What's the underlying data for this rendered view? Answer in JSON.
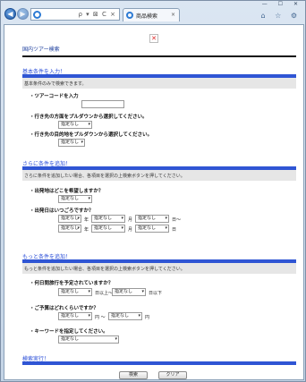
{
  "browser": {
    "tab_title": "商品検索",
    "tab_close": "×",
    "address_icons": "ρ ▾ ⊠ C ×",
    "tool_icons": "⌂ ☆ ⚙",
    "window_controls": "— ☐ ✕",
    "back_glyph": "◀",
    "forward_glyph": "▶"
  },
  "page": {
    "broken_image_glyph": "✕",
    "title": "国内ツアー検索",
    "basic": {
      "heading": "基本条件を入力！",
      "description": "基本条件のみで検索できます。",
      "tour_code_label": "・ツアーコードを入力",
      "destination_area_label": "・行き先の方面をプルダウンから選択してください。",
      "destination_area_select": "指定なし",
      "destination_label": "・行き先の目的地をプルダウンから選択してください。",
      "destination_select": "指定なし"
    },
    "more": {
      "heading": "さらに条件を追加！",
      "description": "さらに条件を追加したい場合、各項目を選択の上検索ボタンを押してください。",
      "departure_place_label": "・出発地はどこを希望しますか？",
      "departure_place_select": "指定なし",
      "departure_date_label": "・出発日はいつごろですか？",
      "date_from": {
        "year": "指定なし",
        "year_suffix": "年",
        "month": "指定なし",
        "month_suffix": "月",
        "day": "指定なし",
        "day_suffix": "日〜"
      },
      "date_to": {
        "year": "指定なし",
        "year_suffix": "年",
        "month": "指定なし",
        "month_suffix": "月",
        "day": "指定なし",
        "day_suffix": "日"
      }
    },
    "extra": {
      "heading": "もっと条件を追加！",
      "description": "もっと条件を追加したい場合、各項目を選択の上検索ボタンを押してください。",
      "nights_label": "・何日間旅行を予定されていますか？",
      "nights_from": "指定なし",
      "nights_from_suffix": "日以上〜",
      "nights_to": "指定なし",
      "nights_to_suffix": "日以下",
      "budget_label": "・ご予算はどれくらいですか？",
      "budget_from": "指定なし",
      "budget_from_suffix": "円 〜",
      "budget_to": "指定なし",
      "budget_to_suffix": "円",
      "keyword_label": "・キーワードを指定してください。",
      "keyword_select": "指定なし"
    },
    "search_exec": {
      "heading": "検索実行！",
      "search_button": "検索",
      "clear_button": "クリア"
    },
    "select_arrow": "▾"
  }
}
